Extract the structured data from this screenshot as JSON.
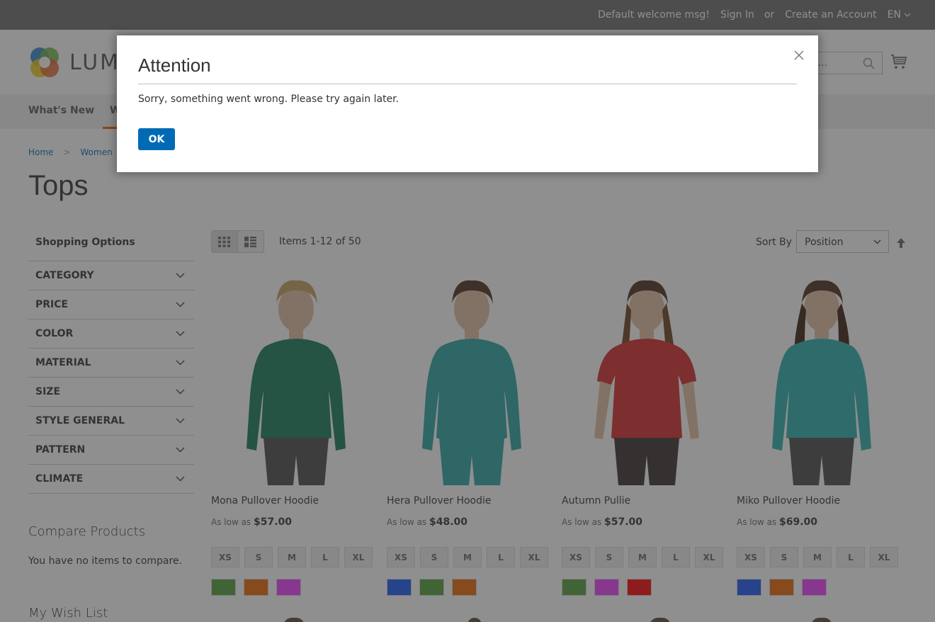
{
  "topbar": {
    "welcome": "Default welcome msg!",
    "sign_in": "Sign In",
    "or": "or",
    "create_account": "Create an Account",
    "language": "EN"
  },
  "header": {
    "logo_text": "LUMA",
    "search_placeholder": "Search entire store here...",
    "search_visible_text": "e...",
    "cart_icon": "cart-icon"
  },
  "nav": {
    "items": [
      {
        "label": "What's New"
      },
      {
        "label": "Women",
        "active": true
      }
    ]
  },
  "breadcrumb": {
    "items": [
      "Home",
      "Women"
    ]
  },
  "page": {
    "title": "Tops"
  },
  "sidebar": {
    "title": "Shopping Options",
    "filters": [
      "CATEGORY",
      "PRICE",
      "COLOR",
      "MATERIAL",
      "SIZE",
      "STYLE GENERAL",
      "PATTERN",
      "CLIMATE"
    ],
    "compare_title": "Compare Products",
    "compare_empty": "You have no items to compare.",
    "wishlist_title": "My Wish List"
  },
  "toolbar": {
    "view_modes": [
      "grid",
      "list"
    ],
    "active_mode": "grid",
    "amount": "Items 1-12 of 50",
    "sort_label": "Sort By",
    "sort_value": "Position",
    "sort_direction": "ascending"
  },
  "products": [
    {
      "name": "Mona Pullover Hoodie",
      "price_prefix": "As low as",
      "price": "$57.00",
      "sizes": [
        "XS",
        "S",
        "M",
        "L",
        "XL"
      ],
      "colors": [
        "#53a13c",
        "#eb6703",
        "#ef3dff"
      ],
      "garment_color": "#167a5a",
      "pants_color": "#4a4a4a"
    },
    {
      "name": "Hera Pullover Hoodie",
      "price_prefix": "As low as",
      "price": "$48.00",
      "sizes": [
        "XS",
        "S",
        "M",
        "L",
        "XL"
      ],
      "colors": [
        "#1857f7",
        "#53a13c",
        "#eb6703"
      ],
      "garment_color": "#2aa5a5",
      "pants_color": "#2aa5a5"
    },
    {
      "name": "Autumn Pullie",
      "price_prefix": "As low as",
      "price": "$57.00",
      "sizes": [
        "XS",
        "S",
        "M",
        "L",
        "XL"
      ],
      "colors": [
        "#53a13c",
        "#ef3dff",
        "#ff0000"
      ],
      "garment_color": "#d82828",
      "pants_color": "#3a3030"
    },
    {
      "name": "Miko Pullover Hoodie",
      "price_prefix": "As low as",
      "price": "$69.00",
      "sizes": [
        "XS",
        "S",
        "M",
        "L",
        "XL"
      ],
      "colors": [
        "#1857f7",
        "#eb6703",
        "#ef3dff"
      ],
      "garment_color": "#2eb0b0",
      "pants_color": "#4a4a4a"
    }
  ],
  "modal": {
    "title": "Attention",
    "message": "Sorry, something went wrong. Please try again later.",
    "ok_label": "OK",
    "close_icon": "close-icon"
  },
  "colors": {
    "accent_blue": "#006bb4",
    "nav_active_underline": "#ff5501",
    "overlay": "rgba(51,51,51,0.55)"
  }
}
